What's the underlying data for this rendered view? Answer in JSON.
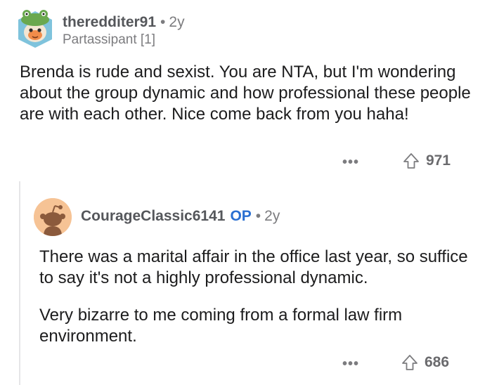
{
  "comment": {
    "author": "theredditer91",
    "separator": "•",
    "age": "2y",
    "flair": "Partassipant [1]",
    "body": "Brenda is rude and sexist. You are NTA, but I'm wondering about the group dynamic and how professional these people are with each other. Nice come back from you haha!",
    "more_label": "•••",
    "score": "971",
    "avatar_icon": "frog-hat-snoo-avatar-icon",
    "reply": {
      "author": "CourageClassic6141",
      "op_badge": "OP",
      "separator": "•",
      "age": "2y",
      "paragraphs": [
        "There was a marital affair in the office last year, so suffice to say it's not a highly professional dynamic.",
        "Very bizarre to me coming from a formal law firm environment."
      ],
      "more_label": "•••",
      "score": "686",
      "avatar_icon": "default-snoo-avatar-icon"
    }
  },
  "colors": {
    "text": "#1c1c1d",
    "meta": "#7c7c7f",
    "op_badge": "#2a6fd1",
    "thread_line": "#e6e6e8",
    "reply_avatar_bg": "#f6c395"
  }
}
